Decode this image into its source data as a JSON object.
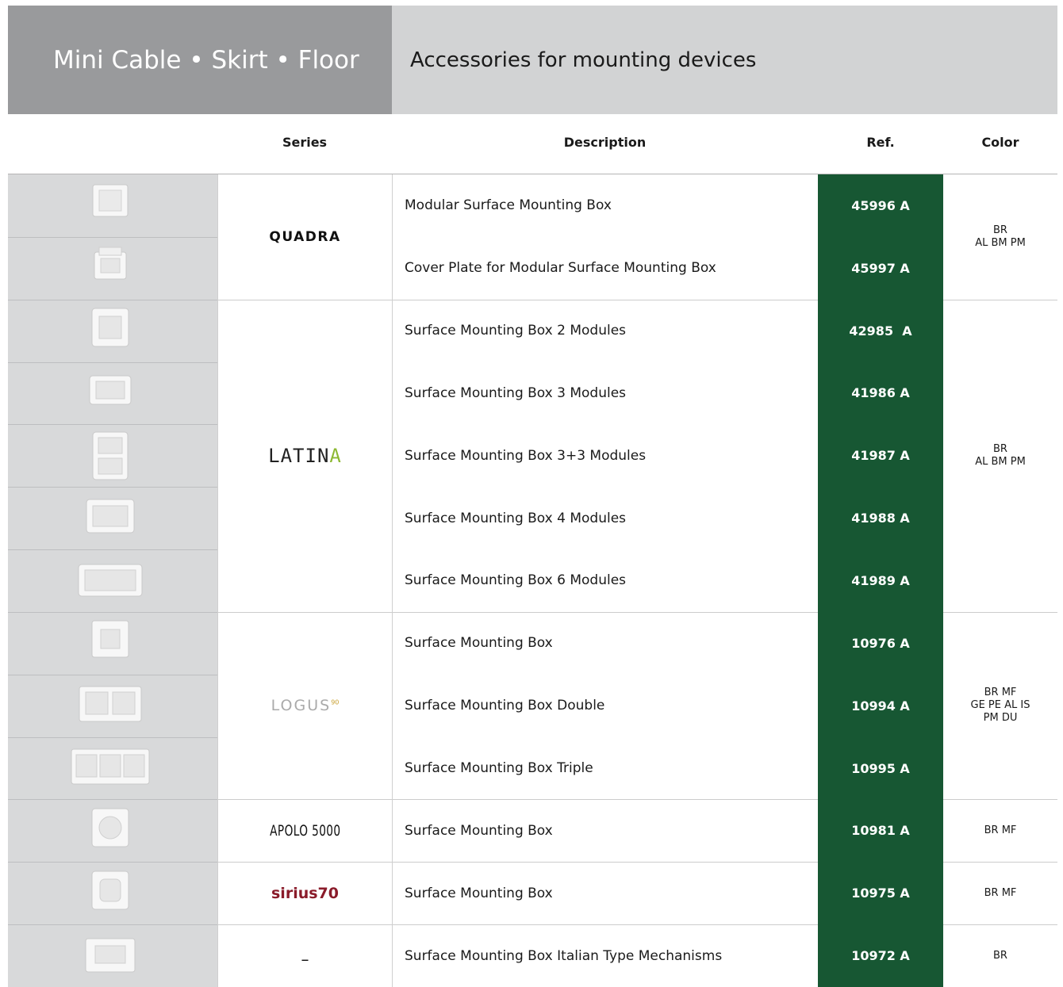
{
  "header": {
    "left_title": "Mini Cable • Skirt • Floor",
    "right_title": "Accessories for mounting devices"
  },
  "columns": {
    "series": "Series",
    "description": "Description",
    "ref": "Ref.",
    "color": "Color"
  },
  "groups": [
    {
      "series": "QUADRA",
      "color": [
        "BR",
        "AL BM PM"
      ],
      "items": [
        {
          "description": "Modular Surface Mounting Box",
          "ref": "45996 A"
        },
        {
          "description": "Cover Plate for Modular Surface Mounting Box",
          "ref": "45997 A"
        }
      ]
    },
    {
      "series": "LATINA",
      "color": [
        "BR",
        "AL BM PM"
      ],
      "items": [
        {
          "description": "Surface Mounting Box 2 Modules",
          "ref": "42985  A"
        },
        {
          "description": "Surface Mounting Box 3 Modules",
          "ref": "41986 A"
        },
        {
          "description": "Surface Mounting Box 3+3 Modules",
          "ref": "41987 A"
        },
        {
          "description": "Surface Mounting Box 4 Modules",
          "ref": "41988 A"
        },
        {
          "description": "Surface Mounting Box 6 Modules",
          "ref": "41989 A"
        }
      ]
    },
    {
      "series": "LOGUS",
      "series_sup": "90",
      "color": [
        "BR MF",
        "GE PE AL IS",
        "PM DU"
      ],
      "items": [
        {
          "description": "Surface Mounting Box",
          "ref": "10976 A"
        },
        {
          "description": "Surface Mounting Box Double",
          "ref": "10994 A"
        },
        {
          "description": "Surface Mounting Box Triple",
          "ref": "10995 A"
        }
      ]
    },
    {
      "series": "APOLO 5000",
      "color": [
        "BR MF"
      ],
      "items": [
        {
          "description": "Surface Mounting Box",
          "ref": "10981 A"
        }
      ]
    },
    {
      "series": "sirius70",
      "color": [
        "BR MF"
      ],
      "items": [
        {
          "description": "Surface Mounting Box",
          "ref": "10975 A"
        }
      ]
    },
    {
      "series": "–",
      "color": [
        "BR"
      ],
      "items": [
        {
          "description": "Surface Mounting Box Italian Type Mechanisms",
          "ref": "10972 A"
        }
      ]
    }
  ]
}
